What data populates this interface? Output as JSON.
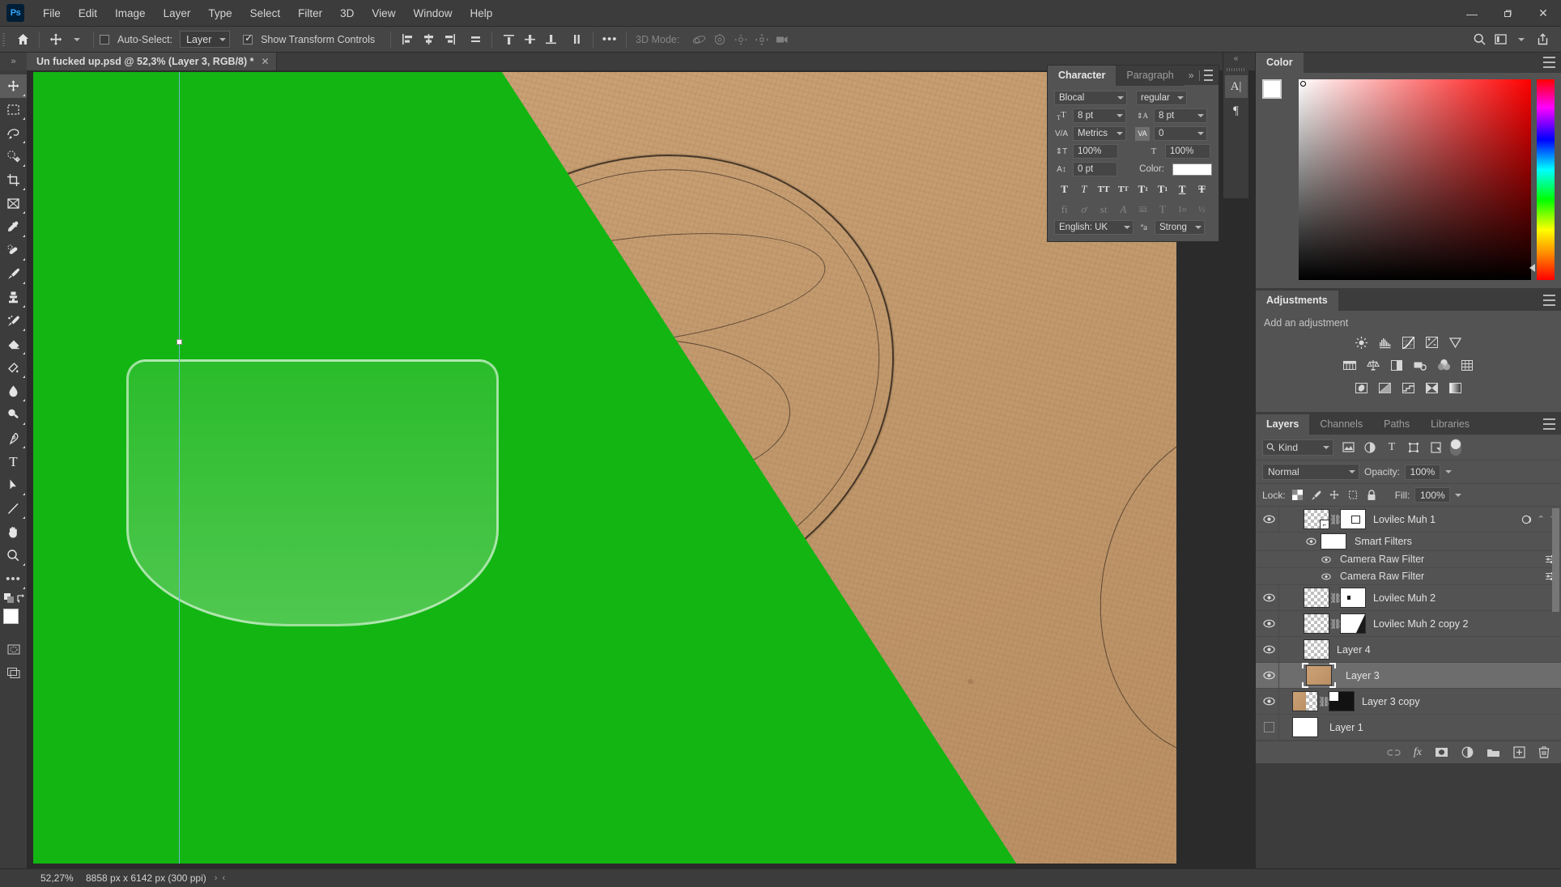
{
  "app": {
    "logo": "Ps"
  },
  "menubar": {
    "items": [
      "File",
      "Edit",
      "Image",
      "Layer",
      "Type",
      "Select",
      "Filter",
      "3D",
      "View",
      "Window",
      "Help"
    ]
  },
  "window_controls": {
    "minimize": "—",
    "restore": "❐",
    "close": "✕"
  },
  "header_tools": {
    "search": "search-icon",
    "workspace": "workspace-icon",
    "share": "share-icon"
  },
  "options_bar": {
    "home_icon": "home-icon",
    "tool_icon": "move-tool-icon",
    "auto_select_label": "Auto-Select:",
    "auto_select_checked": false,
    "target_select_value": "Layer",
    "show_transform_label": "Show Transform Controls",
    "show_transform_checked": true,
    "align_icons": [
      "align-left-edges",
      "align-horizontal-centers",
      "align-right-edges",
      "distribute-horizontal"
    ],
    "distribute_icons": [
      "align-top-edges",
      "align-vertical-centers",
      "align-bottom-edges",
      "distribute-vertical"
    ],
    "more_label": "•••",
    "three_d_label": "3D Mode:",
    "three_d_icons": [
      "orbit-3d-icon",
      "roll-3d-icon",
      "pan-3d-icon",
      "slide-3d-icon",
      "zoom-3d-camera-icon"
    ]
  },
  "tab_bar": {
    "dock_toggle": "»",
    "document_title": "Un fucked up.psd @ 52,3% (Layer 3, RGB/8) *",
    "close": "✕"
  },
  "toolbar": {
    "tools": [
      {
        "name": "move-tool",
        "glyph": "move",
        "active": true
      },
      {
        "name": "rectangular-marquee-tool",
        "glyph": "marquee"
      },
      {
        "name": "lasso-tool",
        "glyph": "lasso"
      },
      {
        "name": "quick-selection-tool",
        "glyph": "quickselect"
      },
      {
        "name": "crop-tool",
        "glyph": "crop"
      },
      {
        "name": "frame-tool",
        "glyph": "frame"
      },
      {
        "name": "eyedropper-tool",
        "glyph": "eyedropper"
      },
      {
        "name": "spot-healing-brush-tool",
        "glyph": "healing"
      },
      {
        "name": "brush-tool",
        "glyph": "brush"
      },
      {
        "name": "clone-stamp-tool",
        "glyph": "stamp"
      },
      {
        "name": "history-brush-tool",
        "glyph": "historybrush"
      },
      {
        "name": "eraser-tool",
        "glyph": "eraser"
      },
      {
        "name": "gradient-tool",
        "glyph": "bucket"
      },
      {
        "name": "blur-tool",
        "glyph": "blur"
      },
      {
        "name": "dodge-tool",
        "glyph": "dodge"
      },
      {
        "name": "pen-tool",
        "glyph": "pen"
      },
      {
        "name": "horizontal-type-tool",
        "glyph": "type"
      },
      {
        "name": "path-selection-tool",
        "glyph": "pathselect"
      },
      {
        "name": "line-tool",
        "glyph": "line"
      },
      {
        "name": "hand-tool",
        "glyph": "hand"
      },
      {
        "name": "zoom-tool",
        "glyph": "zoom"
      },
      {
        "name": "edit-toolbar",
        "glyph": "dots"
      }
    ],
    "swap_colors": "swap-colors-icon",
    "default_colors": "default-colors-icon",
    "foreground_color": "#ffffff",
    "background_color": "#27a9e1",
    "quick_mask": "quick-mask-icon",
    "screen_mode": "screen-mode-icon"
  },
  "canvas": {
    "background_color": "#13b513",
    "paper_color": "#c79f73",
    "guide_color": "#6fb4d8"
  },
  "status_bar": {
    "zoom": "52,27%",
    "doc_size": "8858 px x 6142 px (300 ppi)",
    "expand_arrow": "›",
    "collapse_arrow": "‹"
  },
  "character_panel": {
    "tabs": [
      {
        "label": "Character",
        "active": true
      },
      {
        "label": "Paragraph",
        "active": false
      }
    ],
    "collapse": "»",
    "menu": "panel-menu-icon",
    "font_family": "Blocal",
    "font_style": "regular",
    "font_size": "8 pt",
    "leading": "8 pt",
    "kerning": "Metrics",
    "tracking": "0",
    "vertical_scale": "100%",
    "horizontal_scale": "100%",
    "baseline_shift": "0 pt",
    "color_label": "Color:",
    "color_value": "#ffffff",
    "style_buttons": [
      "faux-bold",
      "faux-italic",
      "all-caps",
      "small-caps",
      "superscript",
      "subscript",
      "underline",
      "strikethrough"
    ],
    "opentype_buttons": [
      "standard-ligatures",
      "contextual-alternates",
      "discretionary-ligatures",
      "swash",
      "old-style",
      "stylistic-alternates",
      "ordinals",
      "fractions"
    ],
    "language": "English: UK",
    "anti_alias_icon": "anti-alias-icon",
    "anti_alias": "Strong"
  },
  "mini_dock": {
    "collapse": "«",
    "buttons": [
      {
        "name": "character-panel-icon",
        "glyph": "A|",
        "active": true
      },
      {
        "name": "paragraph-panel-icon",
        "glyph": "¶",
        "active": false
      }
    ]
  },
  "color_panel": {
    "tab": "Color",
    "menu": "panel-menu-icon",
    "foreground": "#ffffff",
    "background": "#27a9e1",
    "hue": "#ff0000"
  },
  "adjustments_panel": {
    "tab": "Adjustments",
    "menu": "panel-menu-icon",
    "title": "Add an adjustment",
    "row1": [
      "brightness-contrast-icon",
      "levels-icon",
      "curves-icon",
      "exposure-icon",
      "vibrance-icon"
    ],
    "row2": [
      "hue-saturation-icon",
      "color-balance-icon",
      "black-white-icon",
      "photo-filter-icon",
      "channel-mixer-icon",
      "color-lookup-icon"
    ],
    "row3": [
      "invert-icon",
      "posterize-icon",
      "threshold-icon",
      "selective-color-icon",
      "gradient-map-icon"
    ]
  },
  "layers_panel": {
    "tabs": [
      {
        "label": "Layers",
        "active": true
      },
      {
        "label": "Channels",
        "active": false
      },
      {
        "label": "Paths",
        "active": false
      },
      {
        "label": "Libraries",
        "active": false
      }
    ],
    "menu": "panel-menu-icon",
    "filter_kind": "Kind",
    "filter_icons": [
      "filter-pixel-icon",
      "filter-adjustment-icon",
      "filter-type-icon",
      "filter-shape-icon",
      "filter-smart-object-icon"
    ],
    "filter_toggle": "filter-enable-toggle",
    "blend_mode": "Normal",
    "opacity_label": "Opacity:",
    "opacity_value": "100%",
    "lock_label": "Lock:",
    "lock_icons": [
      "lock-transparent-pixels-icon",
      "lock-image-pixels-icon",
      "lock-position-icon",
      "lock-artboard-nesting-icon",
      "lock-all-icon"
    ],
    "fill_label": "Fill:",
    "fill_value": "100%",
    "layers": [
      {
        "name": "Lovilec Muh 1",
        "visible": true,
        "selected": false,
        "thumb": "smart-object",
        "linked": true,
        "mask": "mask-white",
        "has_fx": true,
        "expanded": true,
        "smart_filters_label": "Smart Filters",
        "filters": [
          "Camera Raw Filter",
          "Camera Raw Filter"
        ]
      },
      {
        "name": "Lovilec Muh 2",
        "visible": true,
        "selected": false,
        "thumb": "transparent",
        "linked": true,
        "mask": "mask-dot"
      },
      {
        "name": "Lovilec Muh 2 copy 2",
        "visible": true,
        "selected": false,
        "thumb": "transparent",
        "linked": true,
        "mask": "mask-wedge"
      },
      {
        "name": "Layer 4",
        "visible": true,
        "selected": false,
        "thumb": "transparent"
      },
      {
        "name": "Layer 3",
        "visible": true,
        "selected": true,
        "thumb": "paper"
      },
      {
        "name": "Layer 3 copy",
        "visible": true,
        "selected": false,
        "thumb": "halfpaper",
        "linked": true,
        "mask": "mask-black"
      },
      {
        "name": "Layer 1",
        "visible": false,
        "selected": false,
        "thumb": "white"
      }
    ],
    "footer_icons": [
      "link-layers-icon",
      "add-layer-style-icon",
      "add-layer-mask-icon",
      "new-fill-adjustment-icon",
      "new-group-icon",
      "new-layer-icon",
      "delete-layer-icon"
    ]
  }
}
